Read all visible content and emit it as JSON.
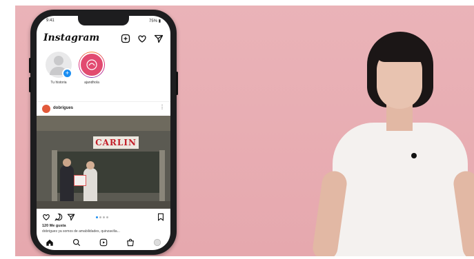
{
  "phone": {
    "status_time": "9:41",
    "status_right": "75% ▮",
    "app_title": "Instagram",
    "stories": [
      {
        "label": "Tu historia"
      },
      {
        "label": "ajandhola"
      }
    ],
    "post": {
      "username": "dobrigues",
      "more": "⋮",
      "sign_text": "CARLIN",
      "likes": "120 Me gusta",
      "caption": "dobrigues ya somos de amabilidades, quinzavilia..."
    }
  },
  "colors": {
    "background": "#e6a8ae",
    "accent_blue": "#1b8ef2"
  },
  "icons": [
    "add-post-icon",
    "heart-icon",
    "send-icon",
    "comment-icon",
    "bookmark-icon",
    "home-icon",
    "search-icon",
    "reels-icon",
    "shop-icon",
    "profile-icon"
  ]
}
